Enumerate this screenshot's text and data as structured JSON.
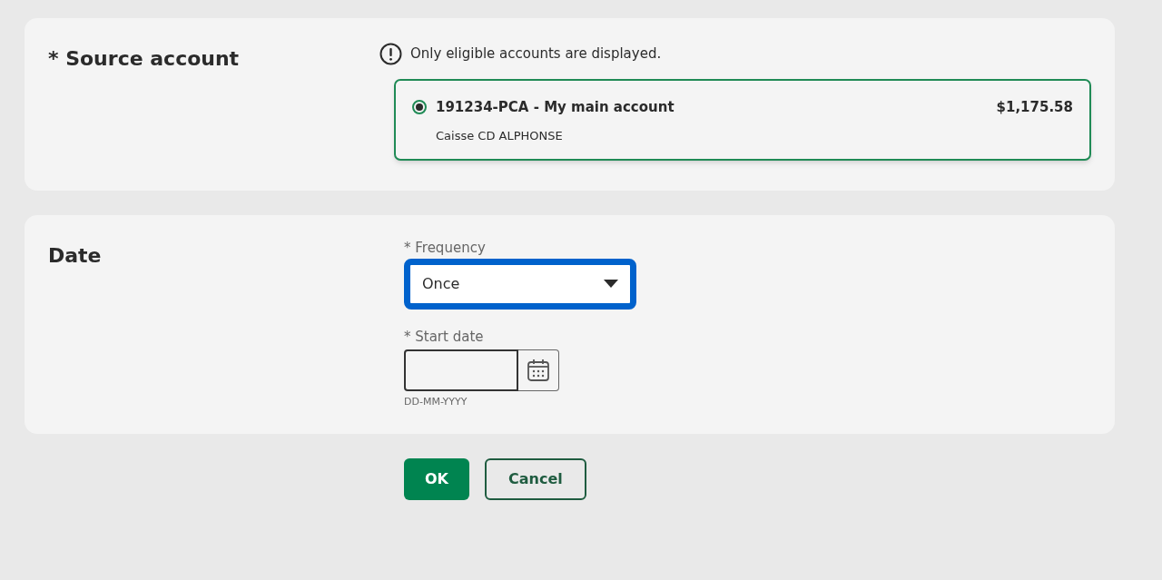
{
  "source_account": {
    "title": "* Source account",
    "notice": "Only eligible accounts are displayed.",
    "accounts": [
      {
        "name": "191234-PCA - My main account",
        "balance": "$1,175.58",
        "branch": "Caisse CD ALPHONSE",
        "selected": true
      }
    ]
  },
  "date": {
    "title": "Date",
    "frequency": {
      "label": "* Frequency",
      "value": "Once",
      "focused": true
    },
    "start_date": {
      "label": "* Start date",
      "hint": "DD-MM-YYYY"
    }
  },
  "buttons": [
    {
      "label": "OK",
      "kind": "primary"
    },
    {
      "label": "Cancel",
      "kind": "secondary"
    }
  ]
}
